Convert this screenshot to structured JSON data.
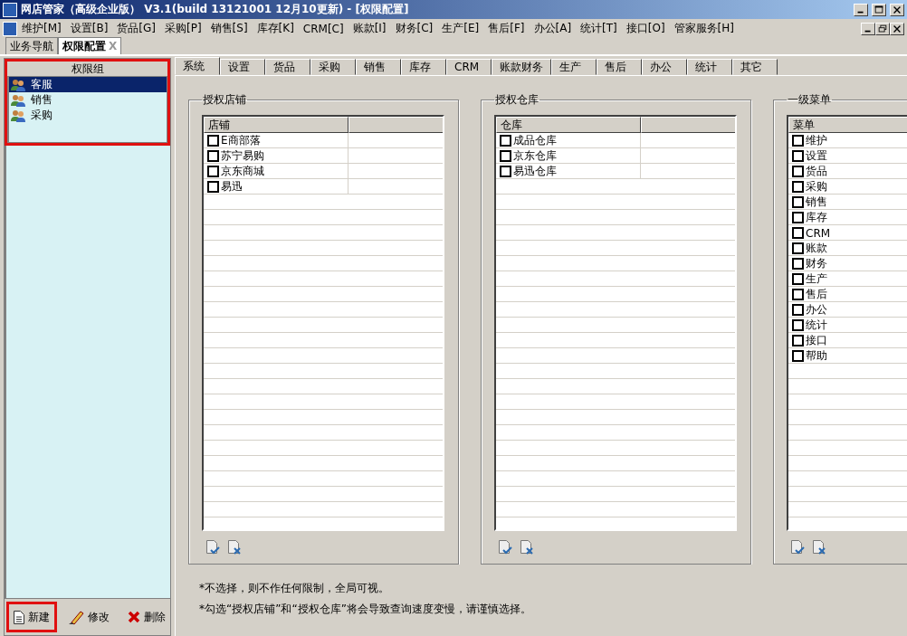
{
  "window": {
    "title": "网店管家（高级企业版） V3.1(build 13121001 12月10更新) - [权限配置]"
  },
  "menu_bar": [
    "维护[M]",
    "设置[B]",
    "货品[G]",
    "采购[P]",
    "销售[S]",
    "库存[K]",
    "CRM[C]",
    "账款[I]",
    "财务[C]",
    "生产[E]",
    "售后[F]",
    "办公[A]",
    "统计[T]",
    "接口[O]",
    "管家服务[H]"
  ],
  "doc_tabs": [
    {
      "label": "业务导航",
      "selected": false
    },
    {
      "label": "权限配置",
      "selected": true,
      "close": "X"
    }
  ],
  "left_panel": {
    "header": "权限组",
    "highlighted": true,
    "groups": [
      {
        "label": "客服",
        "selected": true
      },
      {
        "label": "销售",
        "selected": false
      },
      {
        "label": "采购",
        "selected": false
      }
    ],
    "buttons": [
      {
        "kind": "new",
        "label": "新建",
        "highlighted": true
      },
      {
        "kind": "edit",
        "label": "修改",
        "highlighted": false
      },
      {
        "kind": "delete",
        "label": "删除",
        "highlighted": false
      }
    ]
  },
  "tabs": [
    {
      "label": "系统",
      "selected": true
    },
    {
      "label": "设置",
      "selected": false
    },
    {
      "label": "货品",
      "selected": false
    },
    {
      "label": "采购",
      "selected": false
    },
    {
      "label": "销售",
      "selected": false
    },
    {
      "label": "库存",
      "selected": false
    },
    {
      "label": "CRM",
      "selected": false
    },
    {
      "label": "账款财务",
      "selected": false
    },
    {
      "label": "生产",
      "selected": false
    },
    {
      "label": "售后",
      "selected": false
    },
    {
      "label": "办公",
      "selected": false
    },
    {
      "label": "统计",
      "selected": false
    },
    {
      "label": "其它",
      "selected": false
    }
  ],
  "groups": [
    {
      "title": "授权店铺",
      "column": "店铺",
      "rows": [
        {
          "label": "E商部落",
          "checked": false
        },
        {
          "label": "苏宁易购",
          "checked": false
        },
        {
          "label": "京东商城",
          "checked": false
        },
        {
          "label": "易迅",
          "checked": false
        }
      ]
    },
    {
      "title": "授权仓库",
      "column": "仓库",
      "rows": [
        {
          "label": "成品仓库",
          "checked": false
        },
        {
          "label": "京东仓库",
          "checked": false
        },
        {
          "label": "易迅仓库",
          "checked": false
        }
      ]
    },
    {
      "title": "一级菜单",
      "column": "菜单",
      "rows": [
        {
          "label": "维护",
          "checked": false
        },
        {
          "label": "设置",
          "checked": false
        },
        {
          "label": "货品",
          "checked": false
        },
        {
          "label": "采购",
          "checked": false
        },
        {
          "label": "销售",
          "checked": false
        },
        {
          "label": "库存",
          "checked": false
        },
        {
          "label": "CRM",
          "checked": false
        },
        {
          "label": "账款",
          "checked": false
        },
        {
          "label": "财务",
          "checked": false
        },
        {
          "label": "生产",
          "checked": false
        },
        {
          "label": "售后",
          "checked": false
        },
        {
          "label": "办公",
          "checked": false
        },
        {
          "label": "统计",
          "checked": false
        },
        {
          "label": "接口",
          "checked": false
        },
        {
          "label": "帮助",
          "checked": false
        }
      ]
    }
  ],
  "notes": [
    "*不选择，则不作任何限制，全局可视。",
    "*勾选“授权店铺”和“授权仓库”将会导致查询速度变慢，请谨慎选择。"
  ]
}
